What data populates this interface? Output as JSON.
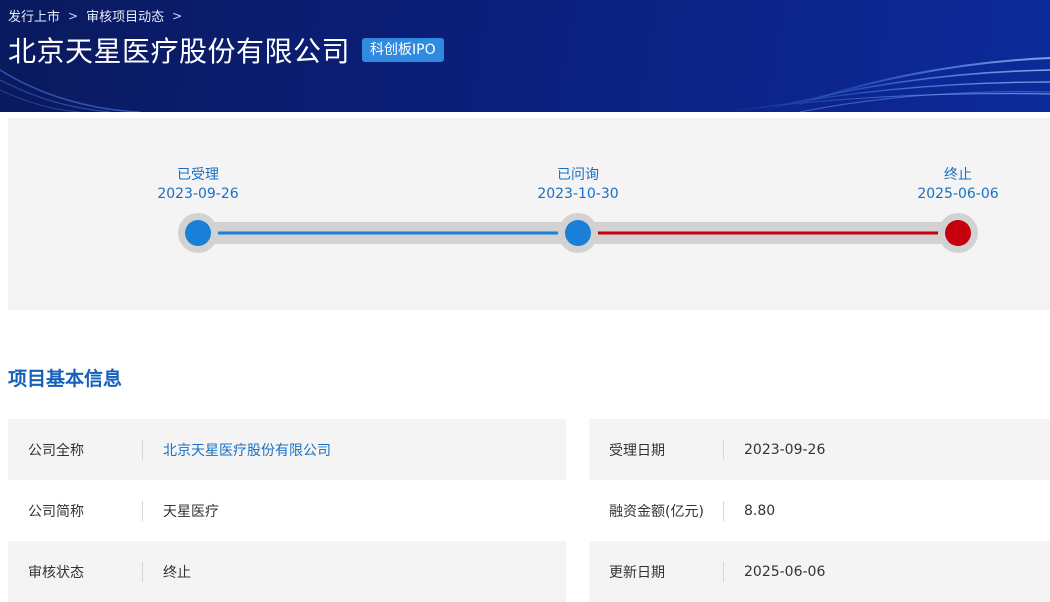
{
  "breadcrumb": {
    "items": [
      "发行上市",
      "审核项目动态"
    ],
    "separator": ">"
  },
  "header": {
    "title": "北京天星医疗股份有限公司",
    "badge": "科创板IPO"
  },
  "progress": {
    "steps": [
      {
        "label": "已受理",
        "date": "2023-09-26",
        "state": "done"
      },
      {
        "label": "已问询",
        "date": "2023-10-30",
        "state": "done"
      },
      {
        "label": "终止",
        "date": "2025-06-06",
        "state": "terminated"
      }
    ],
    "colors": {
      "done": "#1a7fd6",
      "terminated": "#c4000f",
      "track": "#d2d2d2"
    }
  },
  "section": {
    "title": "项目基本信息"
  },
  "info": {
    "left": [
      {
        "label": "公司全称",
        "value": "北京天星医疗股份有限公司"
      },
      {
        "label": "公司简称",
        "value": "天星医疗"
      },
      {
        "label": "审核状态",
        "value": "终止"
      }
    ],
    "right": [
      {
        "label": "受理日期",
        "value": "2023-09-26"
      },
      {
        "label": "融资金额(亿元)",
        "value": "8.80"
      },
      {
        "label": "更新日期",
        "value": "2025-06-06"
      }
    ]
  }
}
